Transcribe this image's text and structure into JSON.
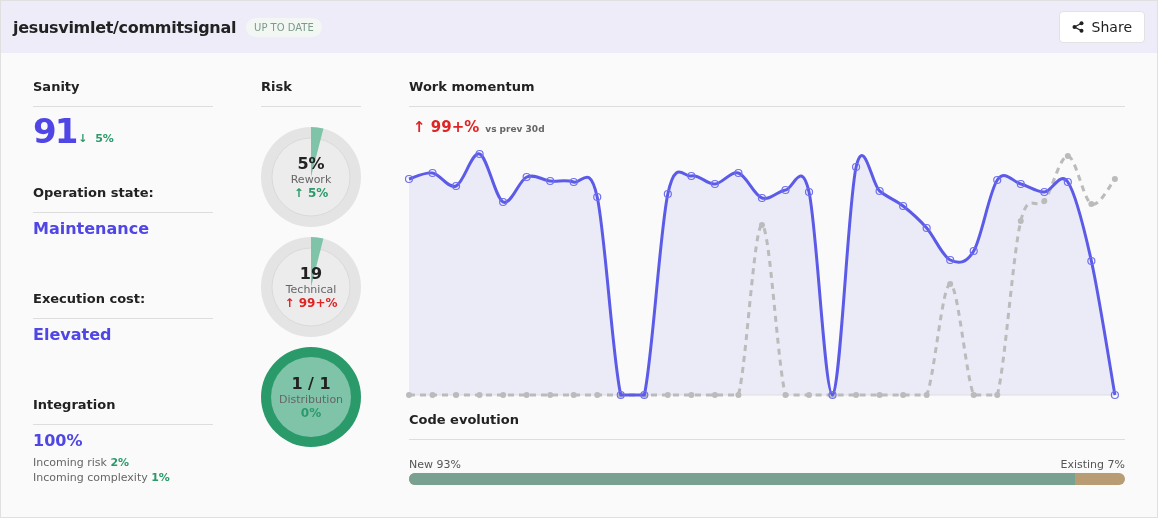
{
  "header": {
    "repo": "jesusvimlet/commitsignal",
    "status": "UP TO DATE",
    "share_button": "Share"
  },
  "sanity": {
    "title": "Sanity",
    "value": "91",
    "trend": {
      "arrow": "↓",
      "value": "5%",
      "color": "#2a9a6a"
    }
  },
  "operation_state": {
    "title": "Operation state:",
    "value": "Maintenance"
  },
  "execution_cost": {
    "title": "Execution cost:",
    "value": "Elevated"
  },
  "integration": {
    "title": "Integration",
    "value": "100%",
    "details": [
      {
        "label": "Incoming risk",
        "value": "2%"
      },
      {
        "label": "Incoming complexity",
        "value": "1%"
      }
    ]
  },
  "risk": {
    "title": "Risk",
    "gauges": [
      {
        "value": "5%",
        "label": "Rework",
        "kind": "partial",
        "trend": {
          "arrow": "↑",
          "value": "5%",
          "color": "#2a9a6a"
        }
      },
      {
        "value": "19",
        "label": "Technical",
        "kind": "partial",
        "trend": {
          "arrow": "↑",
          "value": "99+%",
          "color": "#e02424"
        }
      },
      {
        "value": "1 / 1",
        "label": "Distribution",
        "kind": "complete",
        "trend": {
          "value": "0%",
          "color": "#2a9a6a"
        }
      }
    ]
  },
  "work_momentum": {
    "title": "Work momentum",
    "trend": {
      "arrow": "↑",
      "value": "99+%",
      "color": "#e02424"
    },
    "comparison": "vs prev 30d"
  },
  "code_evolution": {
    "title": "Code evolution",
    "new_label": "New 93%",
    "existing_label": "Existing 7%",
    "level": 0.93
  }
}
